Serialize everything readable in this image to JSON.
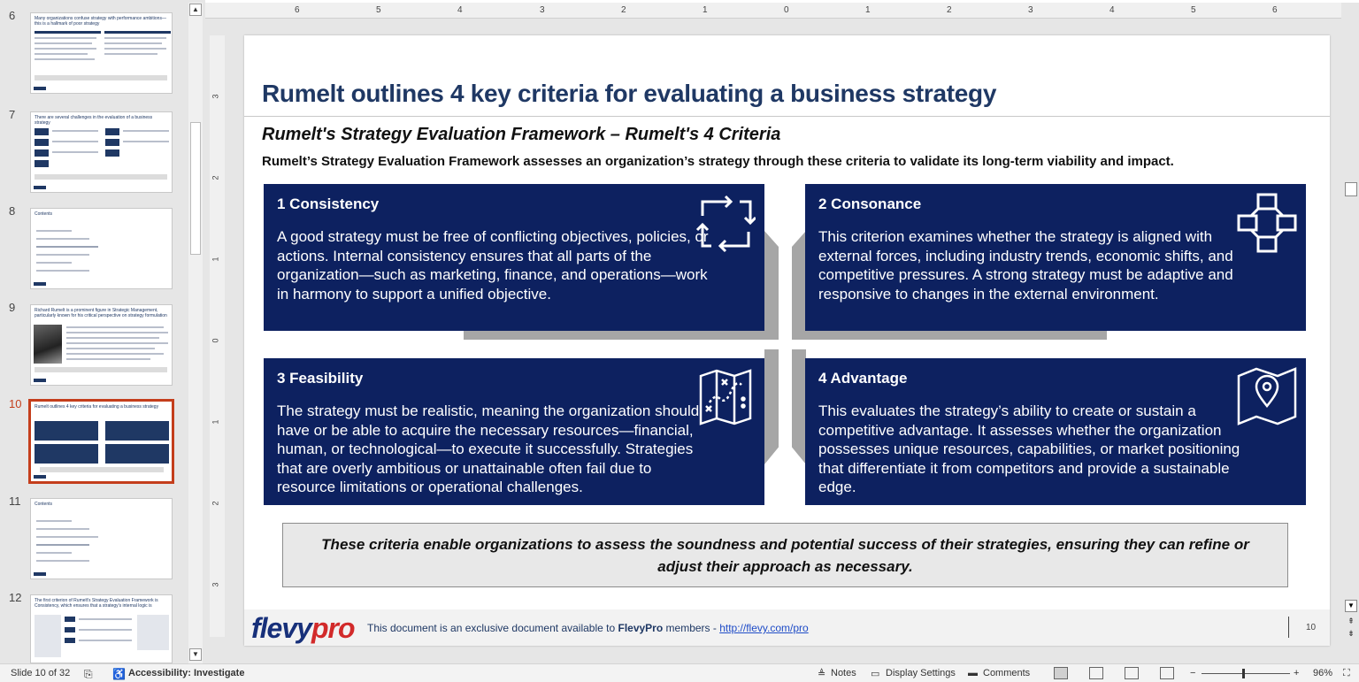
{
  "thumbnails": [
    {
      "num": "6",
      "title": "Many organizations confuse strategy with performance ambitions—this is a hallmark of poor strategy",
      "kind": "two-col"
    },
    {
      "num": "7",
      "title": "There are several challenges in the evaluation of a business strategy",
      "kind": "grid"
    },
    {
      "num": "8",
      "title": "Contents",
      "kind": "contents"
    },
    {
      "num": "9",
      "title": "Richard Rumelt is a prominent figure in Strategic Management, particularly known for his critical perspective on strategy formulation",
      "kind": "photo"
    },
    {
      "num": "10",
      "title": "Rumelt outlines 4 key criteria for evaluating a business strategy",
      "kind": "cards",
      "active": true
    },
    {
      "num": "11",
      "title": "Contents",
      "kind": "contents"
    },
    {
      "num": "12",
      "title": "The first criterion of Rumelt's Strategy Evaluation Framework is Consistency, which ensures that a strategy's internal logic is coherent and free from contradictions",
      "kind": "table"
    }
  ],
  "ruler": {
    "top_numbers": [
      "6",
      "5",
      "4",
      "3",
      "2",
      "1",
      "0",
      "1",
      "2",
      "3",
      "4",
      "5",
      "6"
    ],
    "left_numbers": [
      "3",
      "2",
      "1",
      "0",
      "1",
      "2",
      "3"
    ]
  },
  "slide": {
    "title": "Rumelt outlines 4 key criteria for evaluating a business strategy",
    "subtitle": "Rumelt's Strategy Evaluation Framework – Rumelt's 4 Criteria",
    "intro": "Rumelt’s Strategy Evaluation Framework assesses an organization’s strategy through these criteria to validate its long-term viability and impact.",
    "cards": [
      {
        "title": "1  Consistency",
        "body": "A good strategy must be free of conflicting objectives, policies, or actions. Internal consistency ensures that all parts of the organization—such as marketing, finance, and operations—work in harmony to support a unified objective.",
        "icon": "cycle-arrows-icon"
      },
      {
        "title": "2  Consonance",
        "body": "This criterion examines whether the strategy is aligned with external forces, including industry trends, economic shifts, and competitive pressures. A strong strategy must be adaptive and responsive to changes in the external environment.",
        "icon": "network-blocks-icon"
      },
      {
        "title": "3  Feasibility",
        "body": "The strategy must be realistic, meaning the organization should have or be able to acquire the necessary resources—financial, human, or technological—to execute it successfully. Strategies that are overly ambitious or unattainable often fail due to resource limitations or operational challenges.",
        "icon": "treasure-map-icon"
      },
      {
        "title": "4  Advantage",
        "body": "This evaluates the strategy’s ability to create or sustain a competitive advantage. It assesses whether the organization possesses unique resources, capabilities, or market positioning that differentiate it from competitors and provide a sustainable edge.",
        "icon": "map-pin-icon"
      }
    ],
    "callout": "These criteria enable organizations to assess the soundness and potential success of their strategies, ensuring they can refine or adjust their approach as necessary.",
    "footer": {
      "logo_main": "flevy",
      "logo_pro": "pro",
      "text_before": "This document is an exclusive document available to ",
      "text_bold": "FlevyPro",
      "text_after": " members - ",
      "link": "http://flevy.com/pro",
      "page_number": "10"
    }
  },
  "status_bar": {
    "slide_indicator": "Slide 10 of 32",
    "accessibility": "Accessibility: Investigate",
    "notes": "Notes",
    "display_settings": "Display Settings",
    "comments": "Comments",
    "zoom": "96%"
  },
  "colors": {
    "card_bg": "#0d2160",
    "title": "#1f3864",
    "accent": "#c43e1c",
    "logo_red": "#d22a2a"
  }
}
